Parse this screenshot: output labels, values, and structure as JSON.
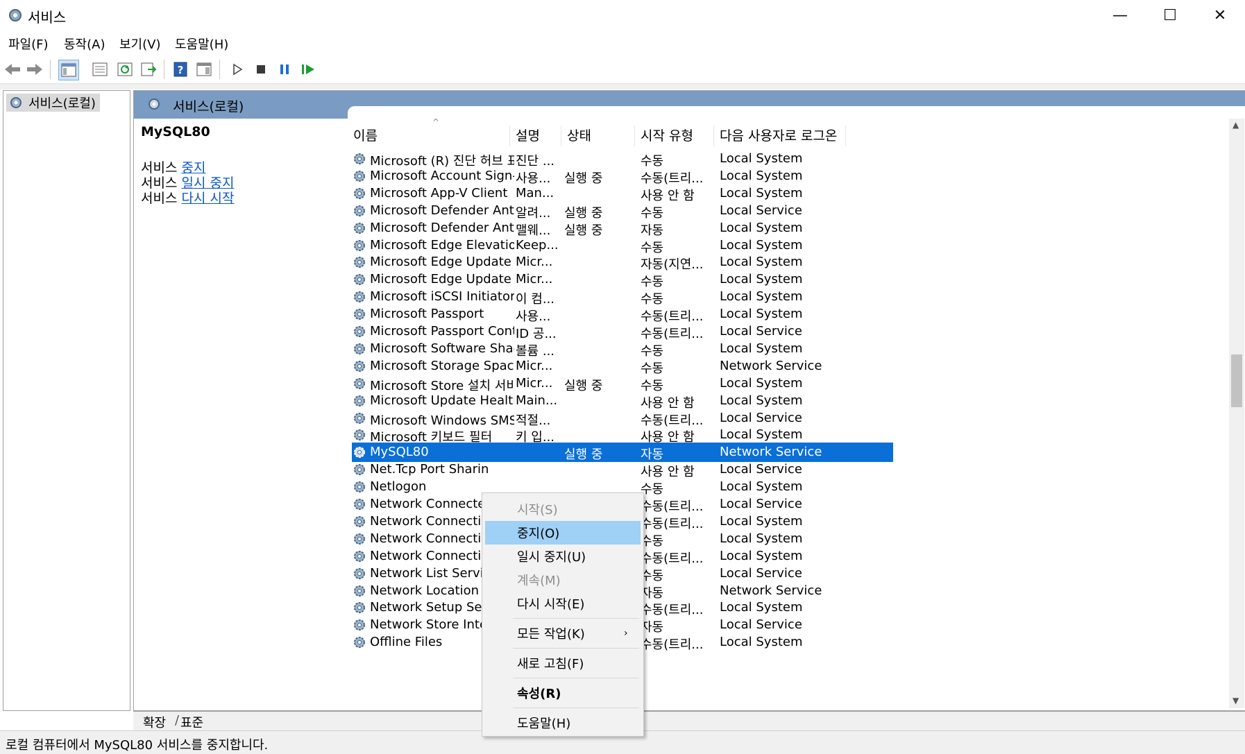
{
  "window": {
    "title": "서비스",
    "minimize": "—",
    "maximize": "☐",
    "close": "✕"
  },
  "menu": [
    "파일(F)",
    "동작(A)",
    "보기(V)",
    "도움말(H)"
  ],
  "toolbar": {
    "icons": [
      "back-arrow-icon",
      "forward-arrow-icon",
      "show-console-tree-icon",
      "properties-icon",
      "refresh-icon",
      "export-list-icon",
      "help-icon",
      "show-action-pane-icon",
      "start-service-icon",
      "stop-service-icon",
      "pause-service-icon",
      "resume-service-icon"
    ],
    "colors": {
      "play": "#3a3a3a",
      "stop": "#3a3a3a",
      "pause": "#1a6fd6",
      "resume": "#1c9c36"
    }
  },
  "tree": {
    "node": "서비스(로컬)"
  },
  "pane": {
    "header": "서비스(로컬)",
    "selected_service": "MySQL80",
    "actions": [
      {
        "prefix": "서비스 ",
        "link": "중지"
      },
      {
        "prefix": "서비스 ",
        "link": "일시 중지"
      },
      {
        "prefix": "서비스 ",
        "link": "다시 시작"
      }
    ]
  },
  "columns": [
    "이름",
    "설명",
    "상태",
    "시작 유형",
    "다음 사용자로 로그온"
  ],
  "rows": [
    {
      "name": "Microsoft (R) 진단 허브 표...",
      "desc": "진단 ...",
      "status": "",
      "startup": "수동",
      "logon": "Local System"
    },
    {
      "name": "Microsoft Account Sign-in ...",
      "desc": "사용...",
      "status": "실행 중",
      "startup": "수동(트리...",
      "logon": "Local System"
    },
    {
      "name": "Microsoft App-V Client",
      "desc": "Man...",
      "status": "",
      "startup": "사용 안 함",
      "logon": "Local System"
    },
    {
      "name": "Microsoft Defender Antiviru...",
      "desc": "알려...",
      "status": "실행 중",
      "startup": "수동",
      "logon": "Local Service"
    },
    {
      "name": "Microsoft Defender Antiviru...",
      "desc": "맬웨...",
      "status": "실행 중",
      "startup": "자동",
      "logon": "Local System"
    },
    {
      "name": "Microsoft Edge Elevation Se...",
      "desc": "Keep...",
      "status": "",
      "startup": "수동",
      "logon": "Local System"
    },
    {
      "name": "Microsoft Edge Update Serv...",
      "desc": "Micr...",
      "status": "",
      "startup": "자동(지연...",
      "logon": "Local System"
    },
    {
      "name": "Microsoft Edge Update Serv...",
      "desc": "Micr...",
      "status": "",
      "startup": "수동",
      "logon": "Local System"
    },
    {
      "name": "Microsoft iSCSI Initiator Ser...",
      "desc": "이 컴...",
      "status": "",
      "startup": "수동",
      "logon": "Local System"
    },
    {
      "name": "Microsoft Passport",
      "desc": "사용...",
      "status": "",
      "startup": "수동(트리...",
      "logon": "Local System"
    },
    {
      "name": "Microsoft Passport Container",
      "desc": "ID 공...",
      "status": "",
      "startup": "수동(트리...",
      "logon": "Local Service"
    },
    {
      "name": "Microsoft Software Shadow...",
      "desc": "볼륨 ...",
      "status": "",
      "startup": "수동",
      "logon": "Local System"
    },
    {
      "name": "Microsoft Storage Spaces S...",
      "desc": "Micr...",
      "status": "",
      "startup": "수동",
      "logon": "Network Service"
    },
    {
      "name": "Microsoft Store 설치 서비스",
      "desc": "Micr...",
      "status": "실행 중",
      "startup": "수동",
      "logon": "Local System"
    },
    {
      "name": "Microsoft Update Health Se...",
      "desc": "Main...",
      "status": "",
      "startup": "사용 안 함",
      "logon": "Local System"
    },
    {
      "name": "Microsoft Windows SMS 라...",
      "desc": "적절...",
      "status": "",
      "startup": "수동(트리...",
      "logon": "Local Service"
    },
    {
      "name": "Microsoft 키보드 필터",
      "desc": "키 입...",
      "status": "",
      "startup": "사용 안 함",
      "logon": "Local System"
    },
    {
      "name": "MySQL80",
      "desc": "",
      "status": "실행 중",
      "startup": "자동",
      "logon": "Network Service",
      "selected": true
    },
    {
      "name": "Net.Tcp Port Sharin",
      "desc": "",
      "status": "",
      "startup": "사용 안 함",
      "logon": "Local Service"
    },
    {
      "name": "Netlogon",
      "desc": "",
      "status": "",
      "startup": "수동",
      "logon": "Local System"
    },
    {
      "name": "Network Connecte",
      "desc": "",
      "status": "",
      "startup": "수동(트리...",
      "logon": "Local Service"
    },
    {
      "name": "Network Connectio",
      "desc": "",
      "status": "",
      "startup": "수동(트리...",
      "logon": "Local System"
    },
    {
      "name": "Network Connectio",
      "desc": "",
      "status": "",
      "startup": "수동",
      "logon": "Local System"
    },
    {
      "name": "Network Connectiv",
      "desc": "",
      "status": "",
      "startup": "수동(트리...",
      "logon": "Local System"
    },
    {
      "name": "Network List Servi",
      "desc": "",
      "status": "",
      "startup": "수동",
      "logon": "Local Service"
    },
    {
      "name": "Network Location",
      "desc": "",
      "status": "",
      "startup": "자동",
      "logon": "Network Service"
    },
    {
      "name": "Network Setup Ser",
      "desc": "",
      "status": "",
      "startup": "수동(트리...",
      "logon": "Local System"
    },
    {
      "name": "Network Store Inte",
      "desc": "",
      "status": "",
      "startup": "자동",
      "logon": "Local Service"
    },
    {
      "name": "Offline Files",
      "desc": "",
      "status": "",
      "startup": "수동(트리...",
      "logon": "Local System"
    }
  ],
  "context_menu": [
    {
      "label": "시작(S)",
      "disabled": true
    },
    {
      "label": "중지(O)",
      "hover": true
    },
    {
      "label": "일시 중지(U)"
    },
    {
      "label": "계속(M)",
      "disabled": true
    },
    {
      "label": "다시 시작(E)"
    },
    {
      "separator": true
    },
    {
      "label": "모든 작업(K)",
      "submenu": true
    },
    {
      "separator": true
    },
    {
      "label": "새로 고침(F)"
    },
    {
      "separator": true
    },
    {
      "label": "속성(R)",
      "bold": true
    },
    {
      "separator": true
    },
    {
      "label": "도움말(H)"
    }
  ],
  "tabs": [
    "확장",
    "표준"
  ],
  "status_bar": "로컬 컴퓨터에서 MySQL80 서비스를 중지합니다."
}
